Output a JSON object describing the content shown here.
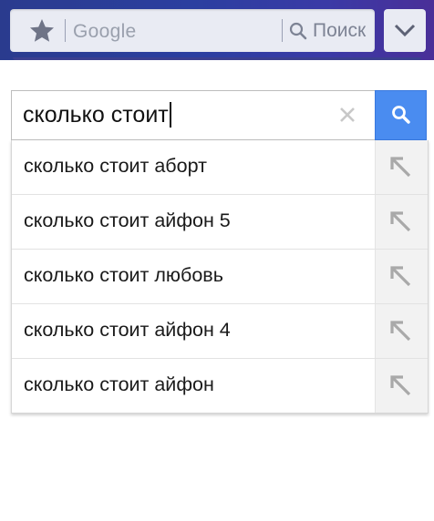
{
  "colors": {
    "topbar_start": "#2a3b8e",
    "topbar_end": "#4a2f98",
    "search_button": "#4a8cf0"
  },
  "browser": {
    "omnibox_placeholder": "Google",
    "omnibox_search_label": "Поиск",
    "bookmark_icon": "star-icon",
    "menu_icon": "chevron-down-icon"
  },
  "search": {
    "query": "сколько стоит",
    "clear_icon": "close-icon",
    "submit_icon": "search-icon"
  },
  "suggestions": [
    {
      "text": "сколько стоит аборт",
      "icon": "arrow-up-left-icon"
    },
    {
      "text": "сколько стоит айфон 5",
      "icon": "arrow-up-left-icon"
    },
    {
      "text": "сколько стоит любовь",
      "icon": "arrow-up-left-icon"
    },
    {
      "text": "сколько стоит айфон 4",
      "icon": "arrow-up-left-icon"
    },
    {
      "text": "сколько стоит айфон",
      "icon": "arrow-up-left-icon"
    }
  ]
}
